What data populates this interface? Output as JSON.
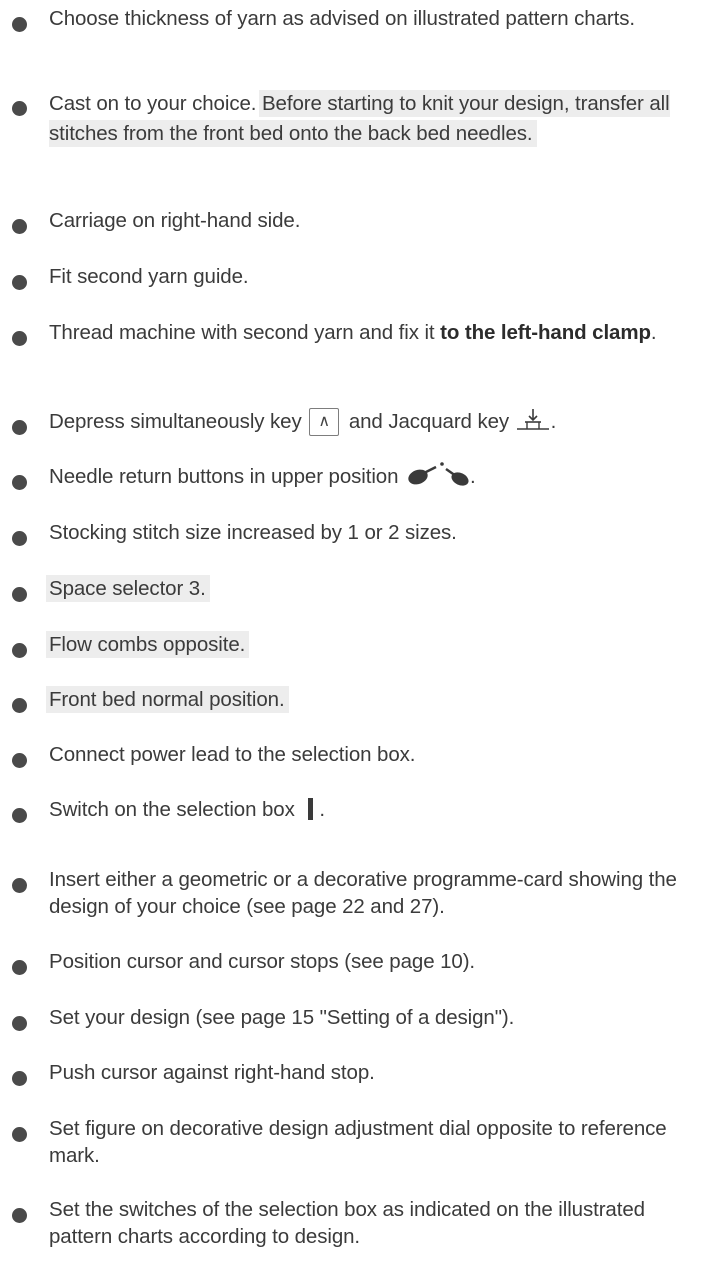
{
  "items": [
    {
      "text": "Choose thickness of yarn as advised on illustrated pattern charts."
    },
    {
      "before": "Cast on to your choice. ",
      "highlight": "Before starting to knit your design, transfer all stitches from the front bed onto the back bed needles."
    },
    {
      "text": "Carriage on right-hand side."
    },
    {
      "text": "Fit second yarn guide."
    },
    {
      "before": "Thread machine with second yarn and fix it ",
      "bold": "to the left-hand clamp",
      "after": "."
    },
    {
      "before": "Depress simultaneously key ",
      "key_symbol": "∧",
      "middle": " and Jacquard key ",
      "after": ".",
      "key_icon": "up-arrow-key-icon",
      "jacquard_icon": "jacquard-key-icon"
    },
    {
      "before": "Needle return buttons in upper position ",
      "after": ".",
      "icon": "needle-return-buttons-icon"
    },
    {
      "text": "Stocking stitch size increased by 1 or 2 sizes."
    },
    {
      "text": "Space selector 3.",
      "highlighted": true
    },
    {
      "text": "Flow combs opposite.",
      "highlighted": true
    },
    {
      "text": "Front bed normal position.",
      "highlighted": true
    },
    {
      "text": "Connect power lead to the selection box."
    },
    {
      "before": "Switch on the selection box ",
      "after": ".",
      "icon": "switch-on-icon"
    },
    {
      "text": "Insert either a geometric or a decorative programme-card showing the design of your choice (see page 22 and 27)."
    },
    {
      "text": "Position cursor and cursor stops (see page 10)."
    },
    {
      "text": "Set your design (see page 15 \"Setting of a design\")."
    },
    {
      "text": "Push cursor against right-hand stop."
    },
    {
      "text": "Set figure on decorative design adjustment dial opposite to reference mark."
    },
    {
      "text": "Set the switches of the selection box as indicated on the illustrated pattern charts according to design."
    }
  ]
}
